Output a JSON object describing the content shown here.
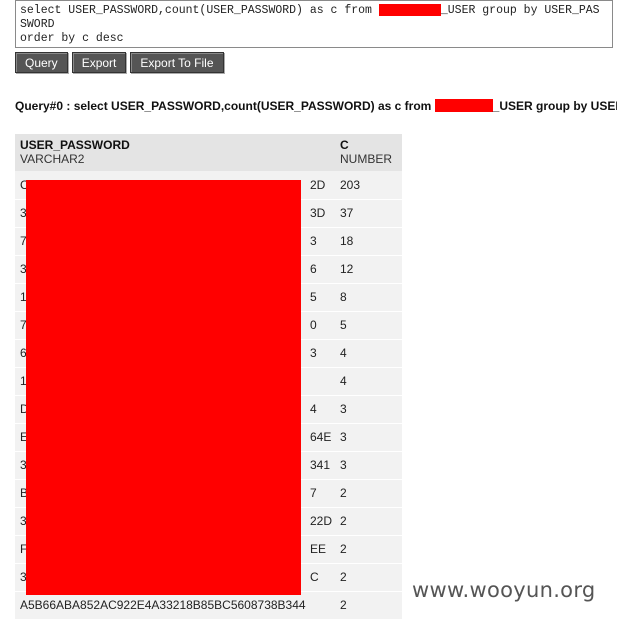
{
  "sql_editor": {
    "line1_before": "select USER_PASSWORD,count(USER_PASSWORD) as c from ",
    "line1_after": "_USER group by USER_PAS",
    "line2": "SWORD",
    "line3": "order by c desc"
  },
  "toolbar": {
    "query_label": "Query",
    "export_label": "Export",
    "export_to_file_label": "Export To File"
  },
  "results": {
    "heading_before": "Query#0 : select USER_PASSWORD,count(USER_PASSWORD) as c from ",
    "heading_after": "_USER group by USER_PASSWORD",
    "columns": [
      {
        "name": "USER_PASSWORD",
        "type": "VARCHAR2"
      },
      {
        "name": "C",
        "type": "NUMBER"
      }
    ],
    "rows": [
      {
        "pw": "C",
        "pw_end": "2D",
        "c": "203"
      },
      {
        "pw": "3",
        "pw_end": "3D",
        "c": "37"
      },
      {
        "pw": "7",
        "pw_end": "3",
        "c": "18"
      },
      {
        "pw": "3",
        "pw_end": "6",
        "c": "12"
      },
      {
        "pw": "1",
        "pw_end": "5",
        "c": "8"
      },
      {
        "pw": "7",
        "pw_end": "0",
        "c": "5"
      },
      {
        "pw": "6",
        "pw_end": "3",
        "c": "4"
      },
      {
        "pw": "1",
        "pw_end": "",
        "c": "4"
      },
      {
        "pw": "D",
        "pw_end": "4",
        "c": "3"
      },
      {
        "pw": "E",
        "pw_end": "64E",
        "c": "3"
      },
      {
        "pw": "3",
        "pw_end": "341",
        "c": "3"
      },
      {
        "pw": "B",
        "pw_end": "7",
        "c": "2"
      },
      {
        "pw": "3",
        "pw_end": "22D",
        "c": "2"
      },
      {
        "pw": "F",
        "pw_end": "EE",
        "c": "2"
      },
      {
        "pw": "3",
        "pw_end": "C",
        "c": "2"
      },
      {
        "pw": "A5B66ABA852AC922E4A33218B85BC5608738B344",
        "pw_end": "",
        "c": "2"
      }
    ]
  },
  "watermark": "www.wooyun.org",
  "colors": {
    "redaction": "#ff0000",
    "button_bg": "#555555",
    "header_bg": "#e4e4e4",
    "row_bg": "#f2f2f2"
  }
}
